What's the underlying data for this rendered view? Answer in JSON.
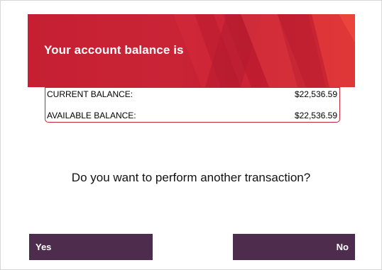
{
  "banner": {
    "title": "Your account balance is"
  },
  "balances": [
    {
      "label": "CURRENT BALANCE:",
      "amount": "$22,536.59"
    },
    {
      "label": "AVAILABLE BALANCE:",
      "amount": "$22,536.59"
    }
  ],
  "prompt": {
    "question": "Do you want to perform another transaction?"
  },
  "actions": {
    "yes_label": "Yes",
    "no_label": "No"
  },
  "colors": {
    "banner_red": "#c61f33",
    "button_purple": "#4e2c4d",
    "box_border": "#c4253a"
  }
}
